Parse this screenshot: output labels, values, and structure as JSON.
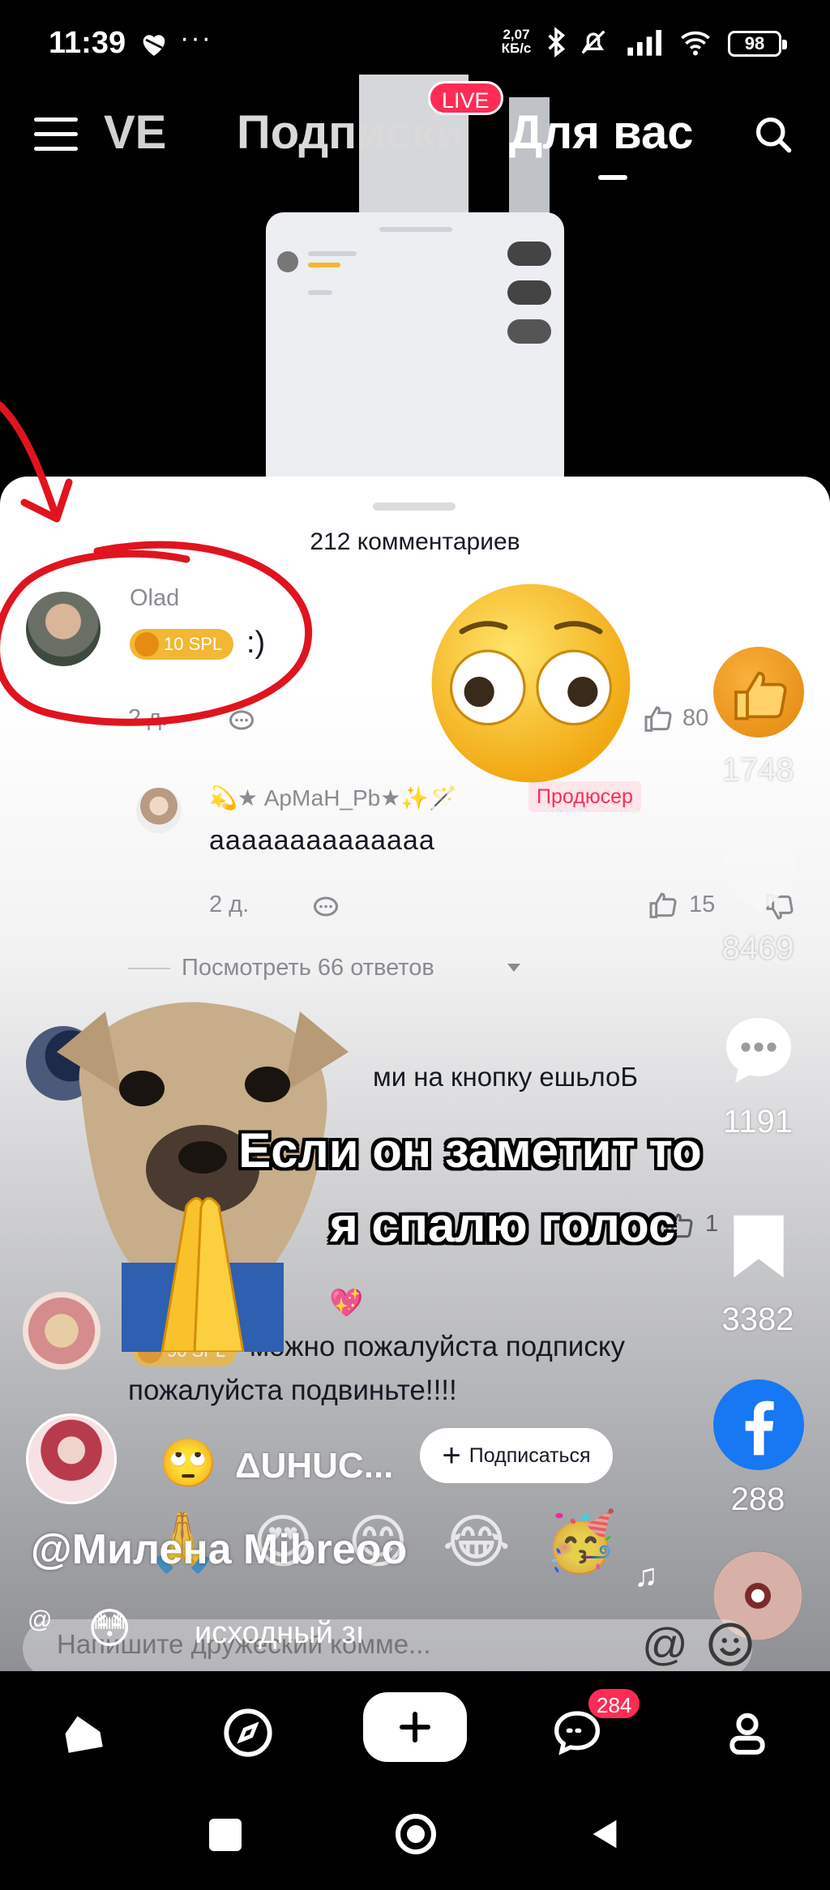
{
  "status_bar": {
    "time": "11:39",
    "extra_dots": "···",
    "speed_value": "2,07",
    "speed_unit": "КБ/с",
    "battery": "98"
  },
  "top_nav": {
    "live_partial": "VE",
    "following_tab": "Подписки",
    "live_badge": "LIVE",
    "for_you_tab": "Для вас"
  },
  "comments": {
    "title": "212 комментариев",
    "items": [
      {
        "author": "Olad",
        "badge": "10 SPL",
        "text": ":)",
        "time": "2 д.",
        "likes": "80"
      },
      {
        "author": "💫★ АрМаН_Рb★✨🪄",
        "role_badge": "Продюсер",
        "text": "аааааааааааааа",
        "time": "2 д.",
        "likes": "15",
        "view_replies": "Посмотреть 66 ответов"
      },
      {
        "text": "ми на кнопку ешьлоБ",
        "likes": "1"
      },
      {
        "badge": "90 SPL",
        "text_line1": "можно пожалуйста подписку",
        "text_line2": "пожалуйста подвиньте!!!!",
        "heart": "💖"
      }
    ],
    "input_placeholder": "Напишите дружеский комме...",
    "input_at": "@"
  },
  "overlay": {
    "caption_line1": "Если он заметит то",
    "caption_line2": "я спалю голос"
  },
  "right_rail": {
    "gift_count": "1748",
    "like_count": "8469",
    "comment_count": "1191",
    "save_count": "3382",
    "share_count": "288"
  },
  "author": {
    "emoji": "🙄",
    "name": "ΔUHUC...",
    "follow_label": "Подписаться",
    "handle": "@Милена Mibreoo",
    "sound_text": "исходный зı",
    "sound_emoji": "😳"
  },
  "emoji_strip": [
    "🙏",
    "😍",
    "😊",
    "😂",
    "🥳"
  ],
  "tabbar": {
    "inbox_badge": "284"
  },
  "colors": {
    "accent": "#fe2c55",
    "annotation_red": "#e0141e",
    "facebook_blue": "#1877f2",
    "spl_gold": "#f2b733"
  }
}
